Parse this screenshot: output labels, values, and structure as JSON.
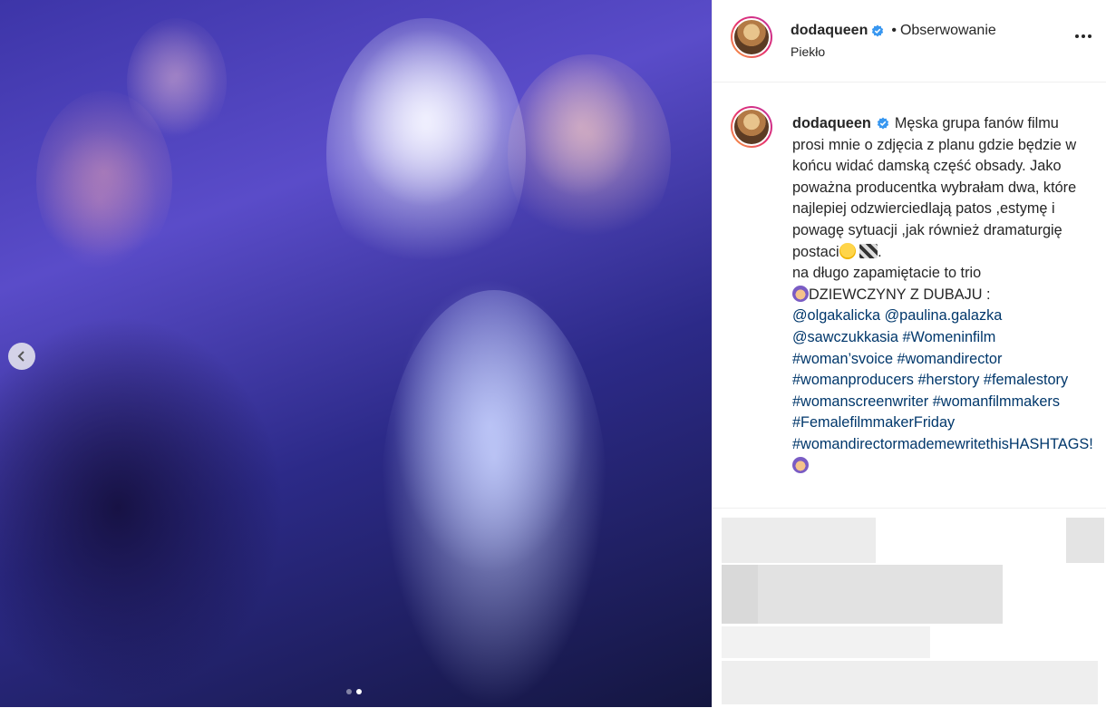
{
  "post": {
    "username": "dodaqueen",
    "follow_label": "Obserwowanie",
    "separator": "•",
    "location": "Piekło"
  },
  "caption": {
    "username": "dodaqueen",
    "line1": "Męska grupa fanów filmu prosi mnie o zdjęcia z planu gdzie będzie w końcu widać damską część obsady. Jako poważna producentka wybrałam dwa, które najlepiej odzwierciedlają patos ,estymę i powagę sytuacji ,jak również dramaturgię postaci",
    "line2": ".",
    "line3": "na długo zapamiętacie to trio",
    "line4": "DZIEWCZYNY Z DUBAJU :",
    "mentions": [
      "@olgakalicka",
      "@paulina.galazka",
      "@sawczukkasia"
    ],
    "hashtags": [
      "#Womeninfilm",
      "#woman’svoice",
      "#womandirector",
      "#womanproducers",
      "#herstory",
      "#femalestory",
      "#womanscreenwriter",
      "#womanfilmmakers",
      "#FemalefilmmakerFriday",
      "#womandirectormademewritethisHASHTAGS!"
    ]
  },
  "carousel": {
    "prev_icon": "chevron-left-icon",
    "slides": 2,
    "active_slide": 2
  },
  "colors": {
    "text": "#262626",
    "link": "#00376b",
    "verified": "#3897f0",
    "border": "#efefef"
  }
}
